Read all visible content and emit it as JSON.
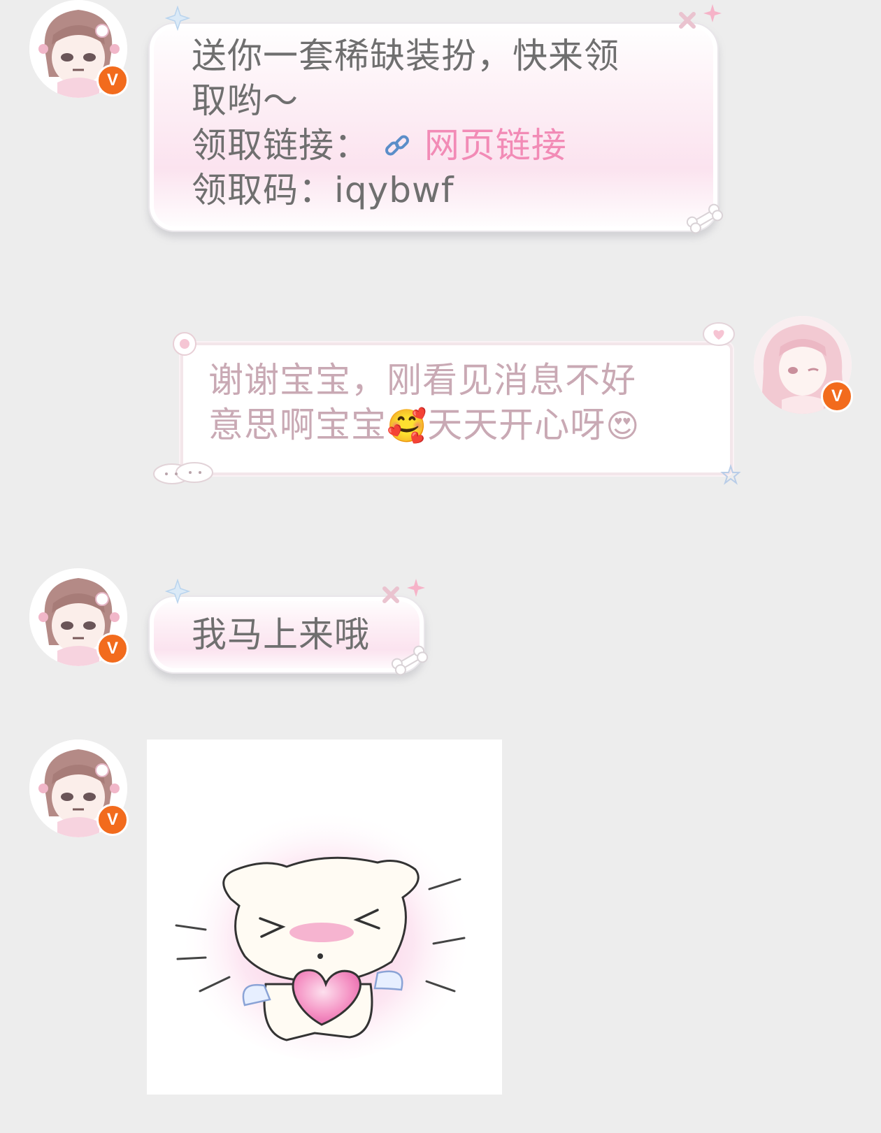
{
  "messages": [
    {
      "side": "left",
      "line1": "送你一套稀缺装扮，快来领",
      "line2": "取哟～",
      "link_prefix": "领取链接：",
      "link_text": "网页链接",
      "code_line": "领取码：iqybwf"
    },
    {
      "side": "right",
      "line1": "谢谢宝宝，刚看见消息不好",
      "line2_a": "意思啊宝宝",
      "emoji_1": "🥰",
      "line2_b": "天天开心呀",
      "emoji_2": "😍"
    },
    {
      "side": "left",
      "text": "我马上来哦"
    },
    {
      "side": "left",
      "type": "sticker"
    }
  ],
  "badge": {
    "letter": "V",
    "color": "#f26b1d"
  },
  "colors": {
    "background": "#ededed",
    "link": "#f28bb6",
    "text": "#6f6f6f",
    "text_soft": "#c9a9b4"
  }
}
